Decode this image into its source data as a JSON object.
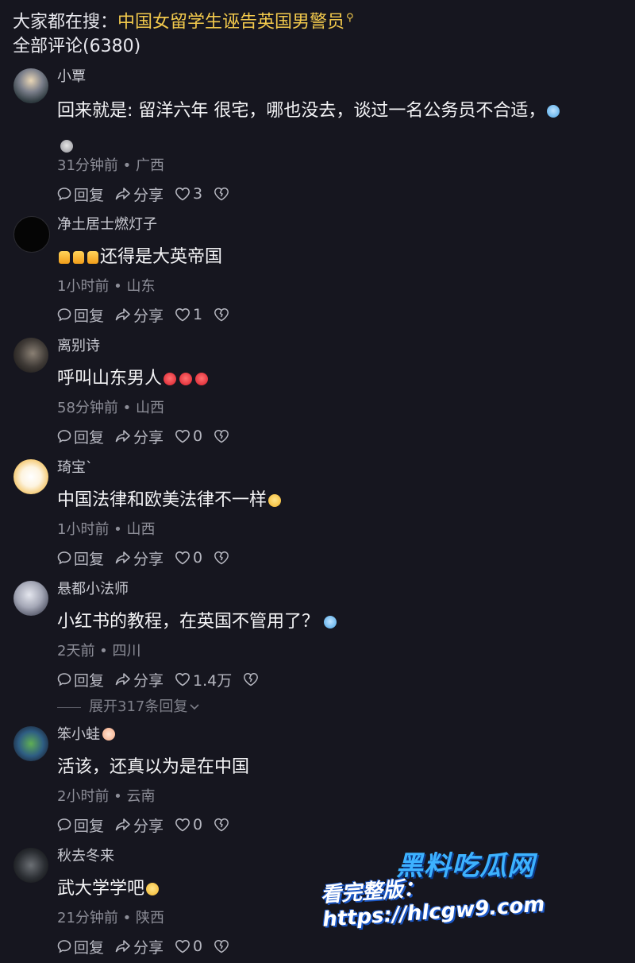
{
  "search_bar": {
    "prefix": "大家都在搜：",
    "term": "中国女留学生诬告英国男警员"
  },
  "comment_count_label": "全部评论(6380)",
  "actions": {
    "reply": "回复",
    "share": "分享"
  },
  "comments": [
    {
      "username": "小覃",
      "text": "回来就是: 留洋六年  很宅，哪也没去，谈过一名公务员不合适，",
      "meta": "31分钟前 • 广西",
      "likes": "3"
    },
    {
      "username": "净土居士燃灯子",
      "text": "还得是大英帝国",
      "meta": "1小时前 • 山东",
      "likes": "1"
    },
    {
      "username": "离别诗",
      "text": "呼叫山东男人",
      "meta": "58分钟前 • 山西",
      "likes": "0"
    },
    {
      "username": "琦宝`",
      "text": "中国法律和欧美法律不一样",
      "meta": "1小时前 • 山西",
      "likes": "0"
    },
    {
      "username": "悬都小法师",
      "text": "小红书的教程，在英国不管用了？",
      "meta": "2天前 • 四川",
      "likes": "1.4万"
    },
    {
      "username": "笨小蛙",
      "text": "活该，还真以为是在中国",
      "meta": "2小时前 • 云南",
      "likes": "0"
    },
    {
      "username": "秋去冬来",
      "text": "武大学学吧",
      "meta": "21分钟前 • 陕西",
      "likes": "0"
    }
  ],
  "expand_replies": "展开317条回复",
  "watermark": {
    "title": "黑料吃瓜网",
    "url": "看完整版：https://hlcgw9.com"
  },
  "colors": {
    "background": "#16161f",
    "search_term": "#f2c94c",
    "watermark_blue": "#3db2ff"
  }
}
